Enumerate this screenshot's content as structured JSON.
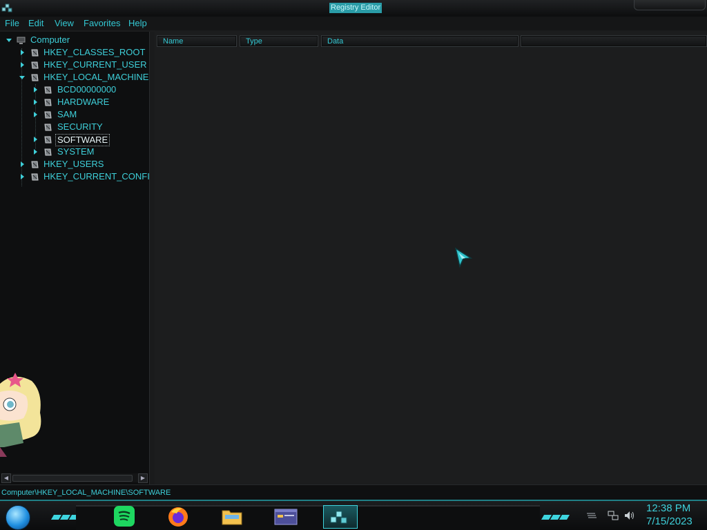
{
  "window": {
    "title": "Registry Editor"
  },
  "menu": {
    "items": [
      "File",
      "Edit",
      "View",
      "Favorites",
      "Help"
    ]
  },
  "tree": {
    "root": "Computer",
    "nodes": [
      {
        "label": "HKEY_CLASSES_ROOT",
        "level": 1,
        "state": "collapsed"
      },
      {
        "label": "HKEY_CURRENT_USER",
        "level": 1,
        "state": "collapsed"
      },
      {
        "label": "HKEY_LOCAL_MACHINE",
        "level": 1,
        "state": "expanded"
      },
      {
        "label": "BCD00000000",
        "level": 2,
        "state": "collapsed"
      },
      {
        "label": "HARDWARE",
        "level": 2,
        "state": "collapsed"
      },
      {
        "label": "SAM",
        "level": 2,
        "state": "collapsed"
      },
      {
        "label": "SECURITY",
        "level": 2,
        "state": "leaf"
      },
      {
        "label": "SOFTWARE",
        "level": 2,
        "state": "collapsed",
        "selected": true
      },
      {
        "label": "SYSTEM",
        "level": 2,
        "state": "collapsed"
      },
      {
        "label": "HKEY_USERS",
        "level": 1,
        "state": "collapsed"
      },
      {
        "label": "HKEY_CURRENT_CONFI",
        "level": 1,
        "state": "collapsed"
      }
    ]
  },
  "list": {
    "columns": [
      "Name",
      "Type",
      "Data"
    ]
  },
  "status": {
    "path": "Computer\\HKEY_LOCAL_MACHINE\\SOFTWARE"
  },
  "taskbar": {
    "apps": [
      "spotify-icon",
      "firefox-icon",
      "file-explorer-icon",
      "window-preview-icon",
      "regedit-icon"
    ],
    "active_app": "regedit-icon",
    "clock": {
      "time": "12:38 PM",
      "date": "7/15/2023"
    }
  },
  "colors": {
    "accent": "#3ecfd9",
    "background": "#1c1d1e",
    "tree_background": "#0e0f10",
    "title_highlight": "#2a9ca7"
  }
}
